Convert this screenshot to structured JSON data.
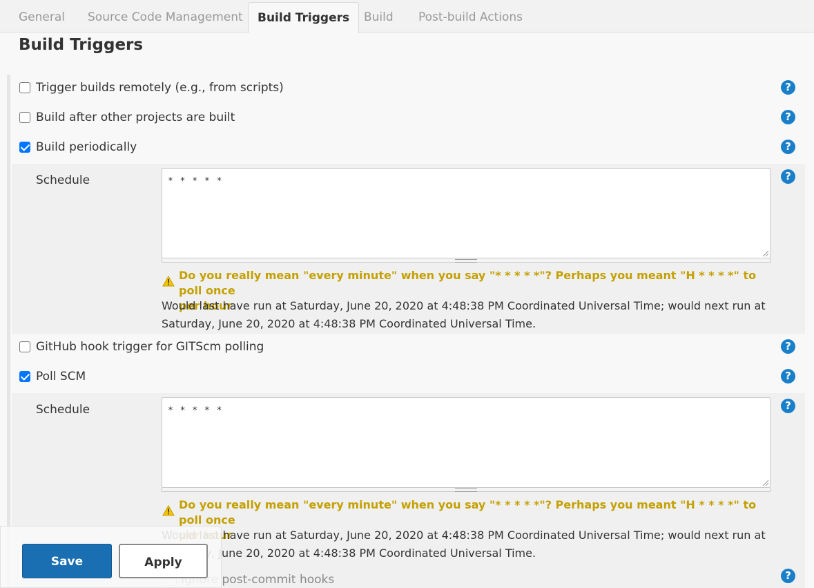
{
  "tabs": [
    {
      "label": "General",
      "active": false
    },
    {
      "label": "Source Code Management",
      "active": false
    },
    {
      "label": "Build Triggers",
      "active": true
    },
    {
      "label": "Build",
      "active": false
    },
    {
      "label": "Post-build Actions",
      "active": false
    }
  ],
  "section": {
    "title": "Build Triggers"
  },
  "triggers": {
    "remote": {
      "label": "Trigger builds remotely (e.g., from scripts)",
      "checked": false
    },
    "after_other": {
      "label": "Build after other projects are built",
      "checked": false
    },
    "periodic": {
      "label": "Build periodically",
      "checked": true
    },
    "github_hook": {
      "label": "GitHub hook trigger for GITScm polling",
      "checked": false
    },
    "poll_scm": {
      "label": "Poll SCM",
      "checked": true
    }
  },
  "periodic_schedule": {
    "label": "Schedule",
    "value": "* * * * *",
    "warning_line1": "Do you really mean \"every minute\" when you say \"* * * * *\"? Perhaps you meant \"H * * * *\" to poll once",
    "warning_line2": "per hour",
    "info_line1": "Would last have run at Saturday, June 20, 2020 at 4:48:38 PM Coordinated Universal Time; would next run at",
    "info_line2": "Saturday, June 20, 2020 at 4:48:38 PM Coordinated Universal Time."
  },
  "scm_schedule": {
    "label": "Schedule",
    "value": "* * * * *",
    "warning_line1": "Do you really mean \"every minute\" when you say \"* * * * *\"? Perhaps you meant \"H * * * *\" to poll once",
    "warning_line2": "per hour",
    "info_line1": "Would last have run at Saturday, June 20, 2020 at 4:48:38 PM Coordinated Universal Time; would next run at",
    "info_line2": "Saturday, June 20, 2020 at 4:48:38 PM Coordinated Universal Time."
  },
  "ignore_hooks": {
    "label": "Ignore post-commit hooks",
    "checked": false
  },
  "actions": {
    "save_label": "Save",
    "apply_label": "Apply"
  },
  "icons": {
    "help": "question-mark-icon",
    "warning": "warning-triangle-icon"
  },
  "colors": {
    "primary": "#1a6fb2",
    "warning_text": "#c4a000",
    "help": "#1a7fc9",
    "checkbox": "#0075ff"
  }
}
